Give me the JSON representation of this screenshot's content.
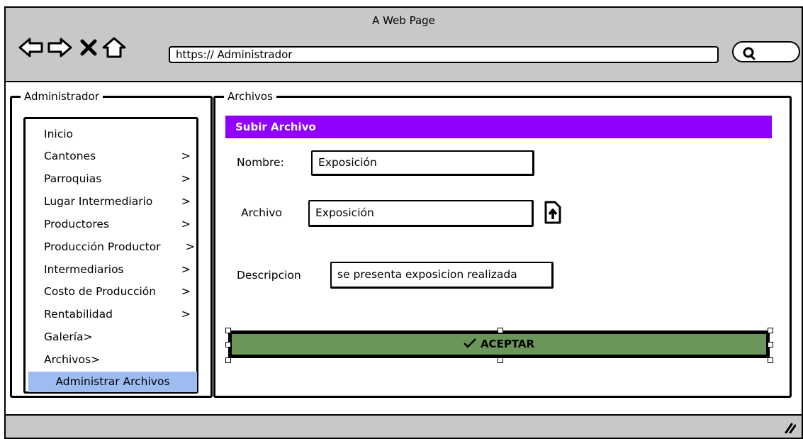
{
  "window": {
    "title": "A Web Page"
  },
  "toolbar": {
    "back_icon": "back-arrow-icon",
    "forward_icon": "forward-arrow-icon",
    "stop_icon": "close-icon",
    "home_icon": "home-icon",
    "url": "https:// Administrador",
    "search_icon": "search-icon"
  },
  "sidebar": {
    "legend": "Administrador",
    "items": [
      {
        "label": "Inicio",
        "chevron": ""
      },
      {
        "label": "Cantones",
        "chevron": ">"
      },
      {
        "label": "Parroquias",
        "chevron": ">"
      },
      {
        "label": "Lugar Intermediario",
        "chevron": ">"
      },
      {
        "label": "Productores",
        "chevron": ">"
      },
      {
        "label": "Producción Productor",
        "chevron": ">"
      },
      {
        "label": "Intermediarios",
        "chevron": ">"
      },
      {
        "label": "Costo de Producción",
        "chevron": ">"
      },
      {
        "label": "Rentabilidad",
        "chevron": ">"
      },
      {
        "label": "Galería>",
        "chevron": ""
      },
      {
        "label": "Archivos>",
        "chevron": ""
      }
    ],
    "active_subitem": "Administrar Archivos"
  },
  "main": {
    "legend": "Archivos",
    "header": "Subir Archivo",
    "form": {
      "nombre_label": "Nombre:",
      "nombre_value": "Exposición",
      "archivo_label": "Archivo",
      "archivo_value": "Exposición",
      "descripcion_label": "Descripcion",
      "descripcion_value": "se presenta exposicion realizada"
    },
    "accept_button": "ACEPTAR"
  },
  "colors": {
    "header_bg": "#8f00ff",
    "accept_bg": "#6a9659",
    "active_item_bg": "#9ebcf0",
    "chrome_bg": "#c8c8c8"
  }
}
